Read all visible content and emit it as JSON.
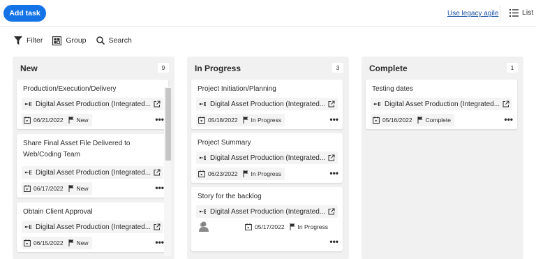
{
  "header": {
    "add_task_label": "Add task",
    "legacy_link": "Use legacy agile",
    "list_label": "List"
  },
  "toolbar": {
    "filter_label": "Filter",
    "group_label": "Group",
    "search_label": "Search"
  },
  "columns": [
    {
      "title": "New",
      "count": "9",
      "cards": [
        {
          "title": "Production/Execution/Delivery",
          "project": "Digital Asset Production (Integrated...",
          "date": "06/21/2022",
          "status": "New"
        },
        {
          "title": "Share Final Asset File Delivered to Web/Coding Team",
          "project": "Digital Asset Production (Integrated...",
          "date": "06/17/2022",
          "status": "New"
        },
        {
          "title": "Obtain Client Approval",
          "project": "Digital Asset Production (Integrated...",
          "date": "06/15/2022",
          "status": "New"
        }
      ]
    },
    {
      "title": "In Progress",
      "count": "3",
      "cards": [
        {
          "title": "Project Initiation/Planning",
          "project": "Digital Asset Production (Integrated...",
          "date": "05/18/2022",
          "status": "In Progress"
        },
        {
          "title": "Project Summary",
          "project": "Digital Asset Production (Integrated...",
          "date": "06/23/2022",
          "status": "In Progress"
        },
        {
          "title": "Story for the backlog",
          "project": "Digital Asset Production (Integrated...",
          "date": "05/17/2022",
          "status": "In Progress"
        }
      ]
    },
    {
      "title": "Complete",
      "count": "1",
      "cards": [
        {
          "title": "Testing dates",
          "project": "Digital Asset Production (Integrated...",
          "date": "05/16/2022",
          "status": "Complete"
        }
      ]
    }
  ],
  "colors": {
    "accent": "#1473e6",
    "link": "#1a4fa0",
    "column_bg": "#f1f1f1"
  },
  "icons": {
    "filter": "filter-icon",
    "group": "group-icon",
    "search": "search-icon",
    "list": "list-icon",
    "project": "project-icon",
    "external": "external-link-icon",
    "calendar": "calendar-icon",
    "flag": "flag-icon",
    "more": "more-icon",
    "avatar": "user-avatar-icon"
  }
}
